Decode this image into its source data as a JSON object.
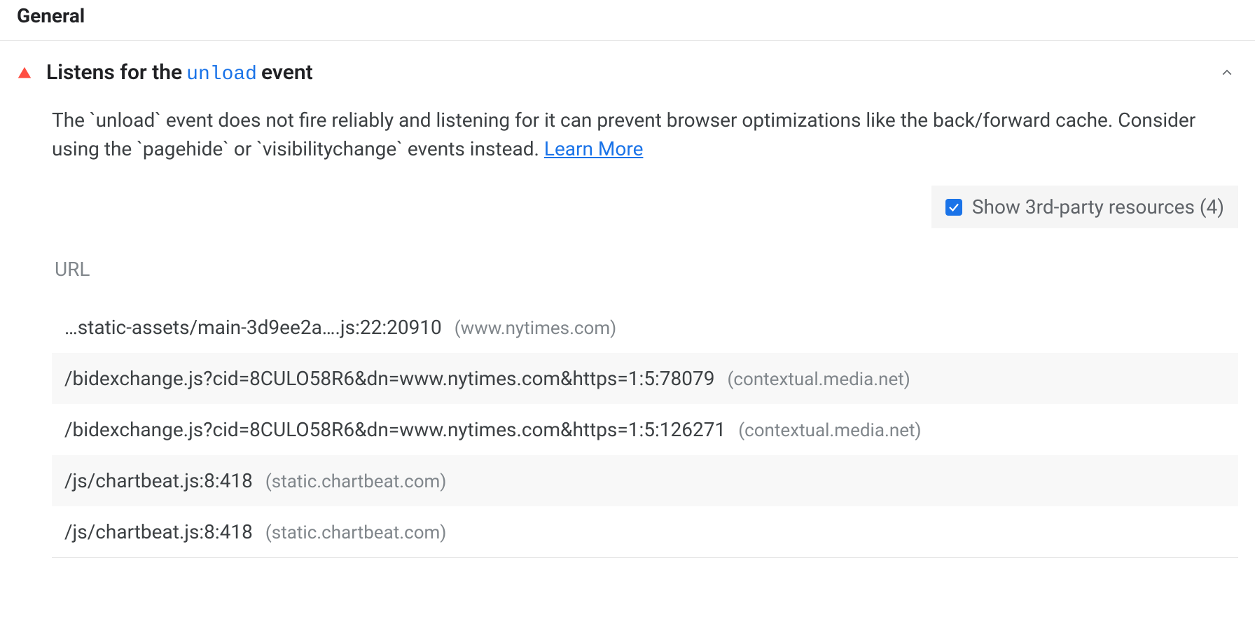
{
  "section": {
    "title": "General"
  },
  "audit": {
    "title_prefix": "Listens for the",
    "title_code": "unload",
    "title_suffix": "event",
    "description": "The `unload` event does not fire reliably and listening for it can prevent browser optimizations like the back/forward cache. Consider using the `pagehide` or `visibilitychange` events instead.",
    "learn_more_label": "Learn More",
    "third_party_label": "Show 3rd-party resources (4)",
    "table_header": "URL",
    "rows": [
      {
        "path": "…static-assets/main-3d9ee2a….js:22:20910",
        "origin": "(www.nytimes.com)"
      },
      {
        "path": "/bidexchange.js?cid=8CULO58R6&dn=www.nytimes.com&https=1:5:78079",
        "origin": "(contextual.media.net)"
      },
      {
        "path": "/bidexchange.js?cid=8CULO58R6&dn=www.nytimes.com&https=1:5:126271",
        "origin": "(contextual.media.net)"
      },
      {
        "path": "/js/chartbeat.js:8:418",
        "origin": "(static.chartbeat.com)"
      },
      {
        "path": "/js/chartbeat.js:8:418",
        "origin": "(static.chartbeat.com)"
      }
    ]
  }
}
